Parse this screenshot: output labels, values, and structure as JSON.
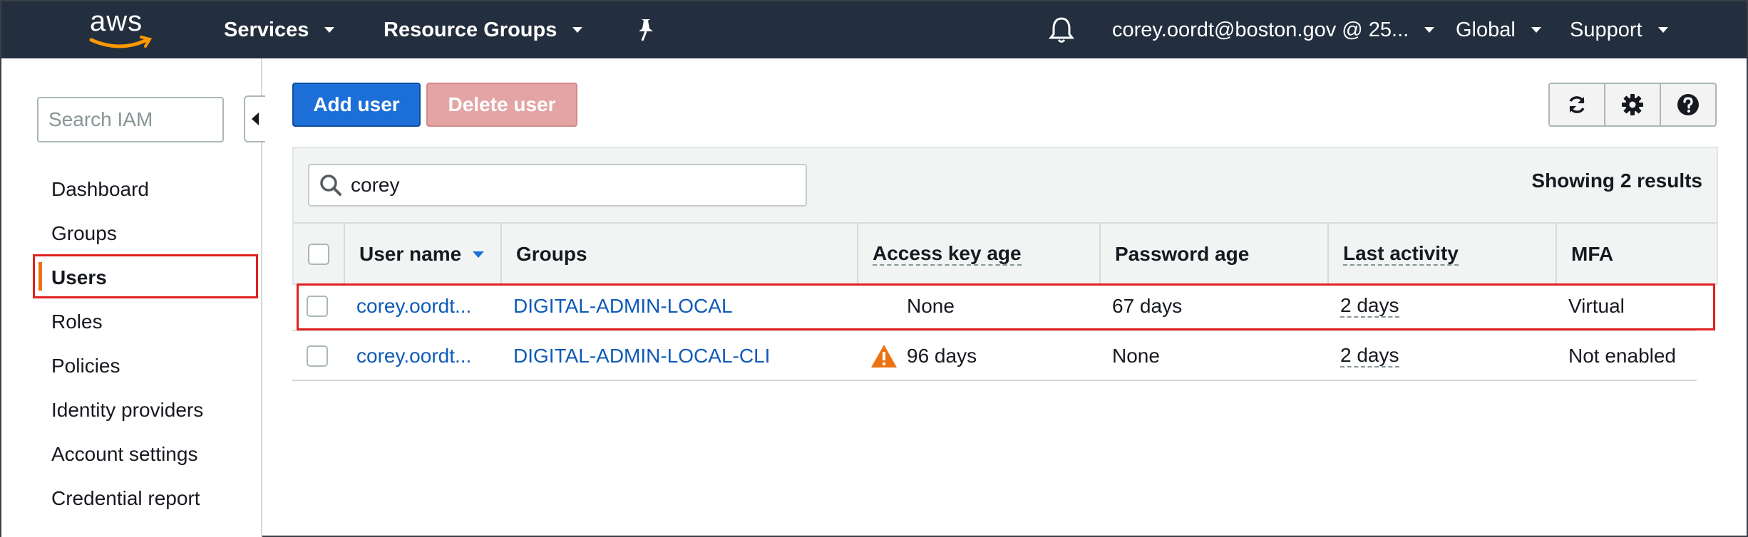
{
  "topnav": {
    "logo_text": "aws",
    "services": "Services",
    "resource_groups": "Resource Groups",
    "account": "corey.oordt@boston.gov @ 25...",
    "region": "Global",
    "support": "Support"
  },
  "sidebar": {
    "search_placeholder": "Search IAM",
    "items": [
      "Dashboard",
      "Groups",
      "Users",
      "Roles",
      "Policies",
      "Identity providers",
      "Account settings",
      "Credential report"
    ],
    "active": "Users"
  },
  "toolbar": {
    "add_user": "Add user",
    "delete_user": "Delete user"
  },
  "filter": {
    "value": "corey"
  },
  "results_text": "Showing 2 results",
  "table": {
    "columns": [
      "User name",
      "Groups",
      "Access key age",
      "Password age",
      "Last activity",
      "MFA"
    ],
    "rows": [
      {
        "user": "corey.oordt...",
        "group": "DIGITAL-ADMIN-LOCAL",
        "access_key_age": "None",
        "password_age": "67 days",
        "last_activity": "2 days",
        "mfa": "Virtual",
        "warning": false
      },
      {
        "user": "corey.oordt...",
        "group": "DIGITAL-ADMIN-LOCAL-CLI",
        "access_key_age": "96 days",
        "password_age": "None",
        "last_activity": "2 days",
        "mfa": "Not enabled",
        "warning": true
      }
    ]
  },
  "colors": {
    "nav_bg": "#232f3e",
    "primary": "#1c6fd6",
    "link": "#0f5ab8",
    "highlight": "#e0201e",
    "warning": "#ec7211"
  }
}
